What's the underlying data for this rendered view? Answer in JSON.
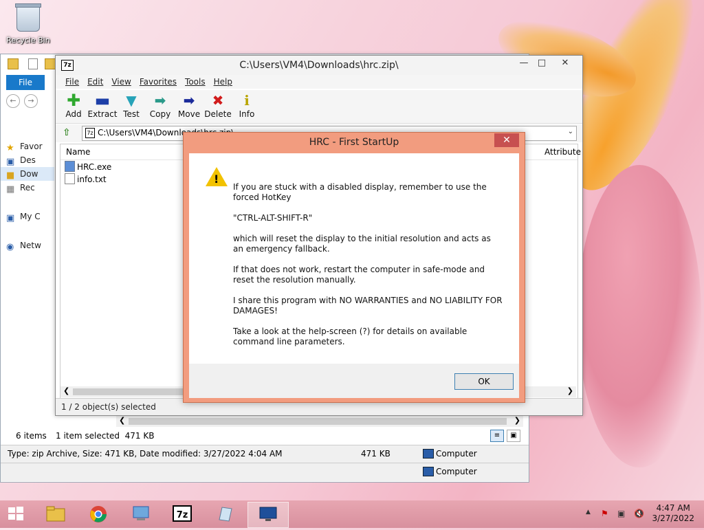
{
  "desktop": {
    "recycle_bin_label": "Recycle Bin"
  },
  "explorer": {
    "file_tab": "File",
    "tree": [
      {
        "label": "Favor",
        "icon": "star-icon"
      },
      {
        "label": "Des",
        "icon": "desktop-icon"
      },
      {
        "label": "Dow",
        "icon": "downloads-folder-icon"
      },
      {
        "label": "Rec",
        "icon": "recent-places-icon"
      },
      {
        "label": "My C",
        "icon": "computer-icon"
      },
      {
        "label": "Netw",
        "icon": "network-icon"
      }
    ],
    "status_items": "6 items",
    "status_selected": "1 item selected  471 KB",
    "details_type": "Type: zip Archive, Size: 471 KB, Date modified: 3/27/2022 4:04 AM",
    "details_size": "471 KB",
    "details_location_1": "Computer",
    "details_location_2": "Computer"
  },
  "zip": {
    "title": "C:\\Users\\VM4\\Downloads\\hrc.zip\\",
    "menu": [
      "File",
      "Edit",
      "View",
      "Favorites",
      "Tools",
      "Help"
    ],
    "toolbar": [
      {
        "label": "Add",
        "icon": "add-icon",
        "color": "#2fa82f"
      },
      {
        "label": "Extract",
        "icon": "extract-icon",
        "color": "#1d3fa8"
      },
      {
        "label": "Test",
        "icon": "test-icon",
        "color": "#27a3b8"
      },
      {
        "label": "Copy",
        "icon": "copy-icon",
        "color": "#2a9a8a"
      },
      {
        "label": "Move",
        "icon": "move-icon",
        "color": "#1a2a9a"
      },
      {
        "label": "Delete",
        "icon": "delete-icon",
        "color": "#d11c1c"
      },
      {
        "label": "Info",
        "icon": "info-icon",
        "color": "#b8a400"
      }
    ],
    "address": "C:\\Users\\VM4\\Downloads\\hrc.zip\\",
    "columns": {
      "name": "Name",
      "attributes": "Attribute"
    },
    "files": [
      {
        "name": "HRC.exe",
        "icon": "exe-file-icon"
      },
      {
        "name": "info.txt",
        "icon": "text-file-icon"
      }
    ],
    "status": "1 / 2 object(s) selected"
  },
  "dialog": {
    "title": "HRC - First StartUp",
    "paragraphs": [
      "If you are stuck with a disabled display, remember to use the forced HotKey",
      "\"CTRL-ALT-SHIFT-R\"",
      "which will reset the display to the initial resolution and acts as an emergency fallback.",
      "If that does not work, restart the computer in safe-mode and reset the resolution manually.",
      "I share this program with NO WARRANTIES and NO LIABILITY FOR DAMAGES!",
      "Take a look at the help-screen (?) for details on available command line parameters."
    ],
    "ok_label": "OK"
  },
  "taskbar": {
    "time": "4:47 AM",
    "date": "3/27/2022",
    "apps": [
      "start-icon",
      "file-explorer-icon",
      "chrome-icon",
      "control-panel-icon",
      "7zip-icon",
      "notepad-icon",
      "display-icon"
    ]
  }
}
